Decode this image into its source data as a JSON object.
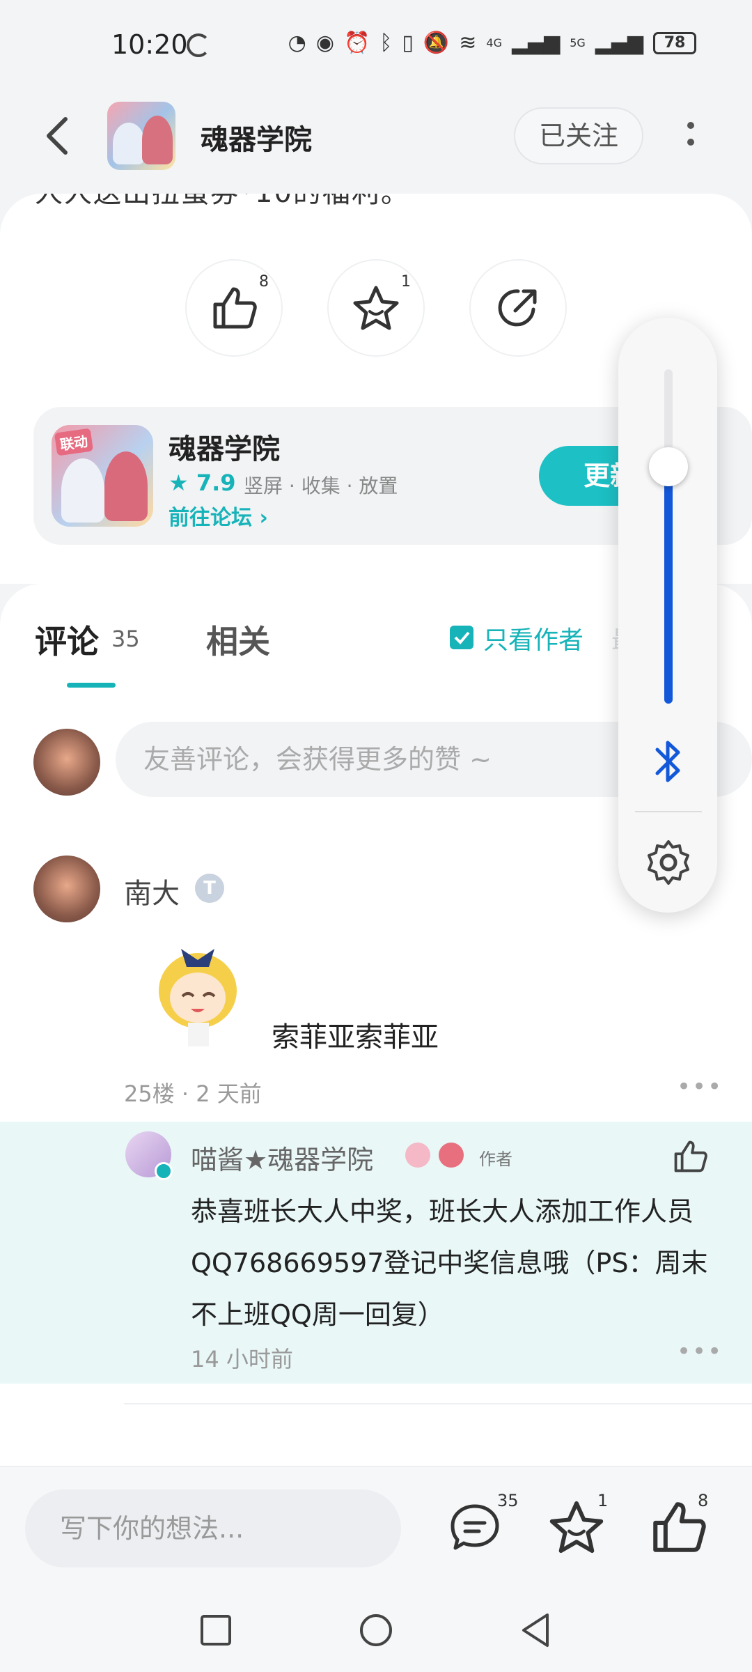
{
  "status_bar": {
    "time": "10:20",
    "battery": "78",
    "signal_4g": "4G",
    "signal_5g": "5G"
  },
  "header": {
    "title": "魂器学院",
    "follow_label": "已关注"
  },
  "post": {
    "cut_text": "人人送出扭蛋券*10的福利。"
  },
  "actions": {
    "like_count": "8",
    "favorite_count": "1"
  },
  "game": {
    "name": "魂器学院",
    "rating": "7.9",
    "tags": "竖屏 · 收集 · 放置",
    "forum_link": "前往论坛",
    "button": "更新"
  },
  "tabs": {
    "comments_label": "评论",
    "comments_count": "35",
    "related_label": "相关",
    "author_only": "只看作者",
    "latest": "最新"
  },
  "comment_input": {
    "placeholder": "友善评论，会获得更多的赞 ~"
  },
  "comment": {
    "author": "南大",
    "badge": "T",
    "text": "索菲亚索菲亚",
    "meta": "25楼 · 2 天前"
  },
  "reply": {
    "author": "喵酱★魂器学院",
    "author_tag": "作者",
    "text": "恭喜班长大人中奖，班长大人添加工作人员QQ768669597登记中奖信息哦（PS：周末不上班QQ周一回复）",
    "meta": "14 小时前"
  },
  "bottom_bar": {
    "placeholder": "写下你的想法...",
    "comment_count": "35",
    "favorite_count": "1",
    "like_count": "8"
  },
  "volume_panel": {
    "level": 0.7,
    "accent": "#1358d9"
  },
  "colors": {
    "accent": "#16b3b9",
    "reply_bg": "#e9f7f7"
  }
}
